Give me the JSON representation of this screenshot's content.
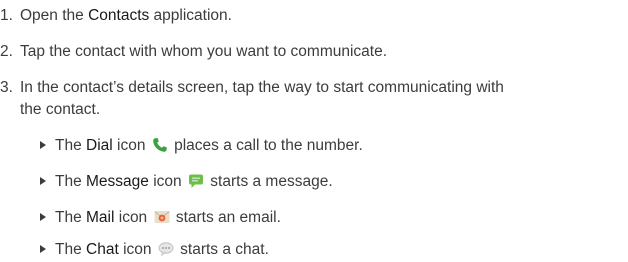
{
  "steps": [
    {
      "num": "1.",
      "pre": "Open the ",
      "bold": "Contacts",
      "post": " application."
    },
    {
      "num": "2.",
      "text": "Tap the contact with whom you want to communicate."
    },
    {
      "num": "3.",
      "line1": "In the contact’s details screen, tap the way to start communicating with",
      "line2": "the contact."
    }
  ],
  "bullets": [
    {
      "pre": "The ",
      "bold": "Dial",
      "mid": " icon",
      "icon": "phone-call-icon",
      "post": " places a call to the number."
    },
    {
      "pre": "The ",
      "bold": "Message",
      "mid": " icon",
      "icon": "message-icon",
      "post": " starts a message."
    },
    {
      "pre": "The ",
      "bold": "Mail",
      "mid": " icon",
      "icon": "mail-icon",
      "post": " starts an email."
    },
    {
      "pre": "The ",
      "bold": "Chat",
      "mid": " icon",
      "icon": "chat-icon",
      "post": " starts a chat."
    }
  ],
  "colors": {
    "text": "#3c3c3c",
    "dial_icon": "#3aa340",
    "message_icon": "#6cc04a",
    "mail_icon": "#e8603c",
    "chat_icon": "#e6e6e6"
  }
}
